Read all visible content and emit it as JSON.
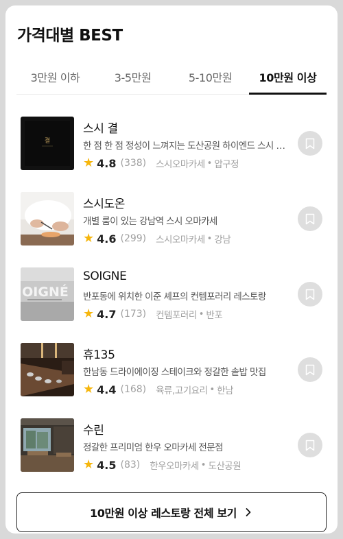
{
  "section": {
    "title": "가격대별 BEST"
  },
  "tabs": [
    {
      "label": "3만원 이하",
      "active": false
    },
    {
      "label": "3-5만원",
      "active": false
    },
    {
      "label": "5-10만원",
      "active": false
    },
    {
      "label": "10만원 이상",
      "active": true
    }
  ],
  "restaurants": [
    {
      "name": "스시 결",
      "description": "한 점 한 점 정성이 느껴지는 도산공원 하이엔드 스시 오마카세",
      "rating": "4.8",
      "review_count": "(338)",
      "category": "스시오마카세",
      "location": "압구정",
      "thumbnail_text": "결",
      "bookmark_icon": "bookmark-icon"
    },
    {
      "name": "스시도온",
      "description": "개별 룸이 있는 강남역 스시 오마카세",
      "rating": "4.6",
      "review_count": "(299)",
      "category": "스시오마카세",
      "location": "강남",
      "bookmark_icon": "bookmark-icon"
    },
    {
      "name": "SOIGNE",
      "description": "반포동에 위치한 이준 셰프의 컨템포러리 레스토랑",
      "rating": "4.7",
      "review_count": "(173)",
      "category": "컨템포러리",
      "location": "반포",
      "thumbnail_text": "OIGNÉ",
      "bookmark_icon": "bookmark-icon"
    },
    {
      "name": "휴135",
      "description": "한남동 드라이에이징 스테이크와 정갈한 솥밥 맛집",
      "rating": "4.4",
      "review_count": "(168)",
      "category": "육류,고기요리",
      "location": "한남",
      "bookmark_icon": "bookmark-icon"
    },
    {
      "name": "수린",
      "description": "정갈한 프리미엄 한우 오마카세 전문점",
      "rating": "4.5",
      "review_count": "(83)",
      "category": "한우오마카세",
      "location": "도산공원",
      "bookmark_icon": "bookmark-icon"
    }
  ],
  "more_button": {
    "label": "10만원 이상 레스토랑 전체 보기"
  },
  "colors": {
    "star": "#f6b60d",
    "accent": "#111111",
    "bookmark_bg": "#dedede"
  }
}
